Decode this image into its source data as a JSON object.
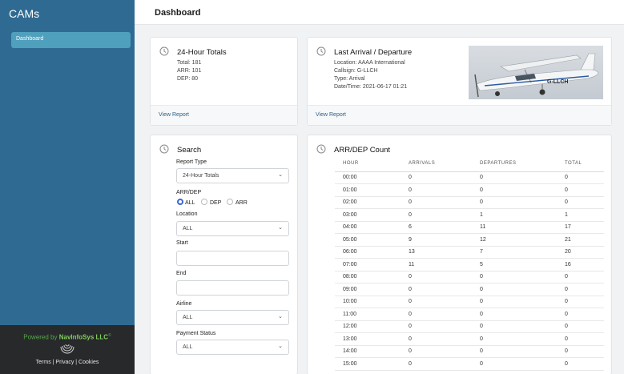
{
  "app": {
    "brand": "CAMs"
  },
  "sidebar": {
    "items": [
      {
        "label": "Dashboard"
      }
    ]
  },
  "footer": {
    "powered_prefix": "Powered by ",
    "company": "NavInfoSys LLC",
    "copyright": "©",
    "links": "Terms | Privacy | Cookies"
  },
  "header": {
    "title": "Dashboard"
  },
  "totals_card": {
    "title": "24-Hour Totals",
    "total": "Total: 181",
    "arr": "ARR: 101",
    "dep": "DEP: 80",
    "link": "View Report"
  },
  "last_card": {
    "title": "Last Arrival / Departure",
    "location": "Location: AAAA International",
    "callsign": "Callsign: G-LLCH",
    "type": "Type: Arrival",
    "datetime": "Date/Time: 2021-06-17 01:21",
    "link": "View Report",
    "photo_reg": "G-LLCH"
  },
  "search": {
    "title": "Search",
    "report_type_label": "Report Type",
    "report_type_value": "24-Hour Totals",
    "arrdep_label": "ARR/DEP",
    "radios": [
      "ALL",
      "DEP",
      "ARR"
    ],
    "selected_radio": "ALL",
    "location_label": "Location",
    "location_value": "ALL",
    "start_label": "Start",
    "end_label": "End",
    "airline_label": "Airline",
    "airline_value": "ALL",
    "payment_label": "Payment Status",
    "payment_value": "ALL"
  },
  "count_card": {
    "title": "ARR/DEP Count",
    "columns": [
      "HOUR",
      "ARRIVALS",
      "DEPARTURES",
      "TOTAL"
    ],
    "rows": [
      [
        "00:00",
        "0",
        "0",
        "0"
      ],
      [
        "01:00",
        "0",
        "0",
        "0"
      ],
      [
        "02:00",
        "0",
        "0",
        "0"
      ],
      [
        "03:00",
        "0",
        "1",
        "1"
      ],
      [
        "04:00",
        "6",
        "11",
        "17"
      ],
      [
        "05:00",
        "9",
        "12",
        "21"
      ],
      [
        "06:00",
        "13",
        "7",
        "20"
      ],
      [
        "07:00",
        "11",
        "5",
        "16"
      ],
      [
        "08:00",
        "0",
        "0",
        "0"
      ],
      [
        "09:00",
        "0",
        "0",
        "0"
      ],
      [
        "10:00",
        "0",
        "0",
        "0"
      ],
      [
        "11:00",
        "0",
        "0",
        "0"
      ],
      [
        "12:00",
        "0",
        "0",
        "0"
      ],
      [
        "13:00",
        "0",
        "0",
        "0"
      ],
      [
        "14:00",
        "0",
        "0",
        "0"
      ],
      [
        "15:00",
        "0",
        "0",
        "0"
      ]
    ]
  },
  "colors": {
    "sidebar": "#2f6a92",
    "nav_active": "#4fa0bd",
    "link": "#2b5f86",
    "radio_on": "#3a66d6"
  }
}
